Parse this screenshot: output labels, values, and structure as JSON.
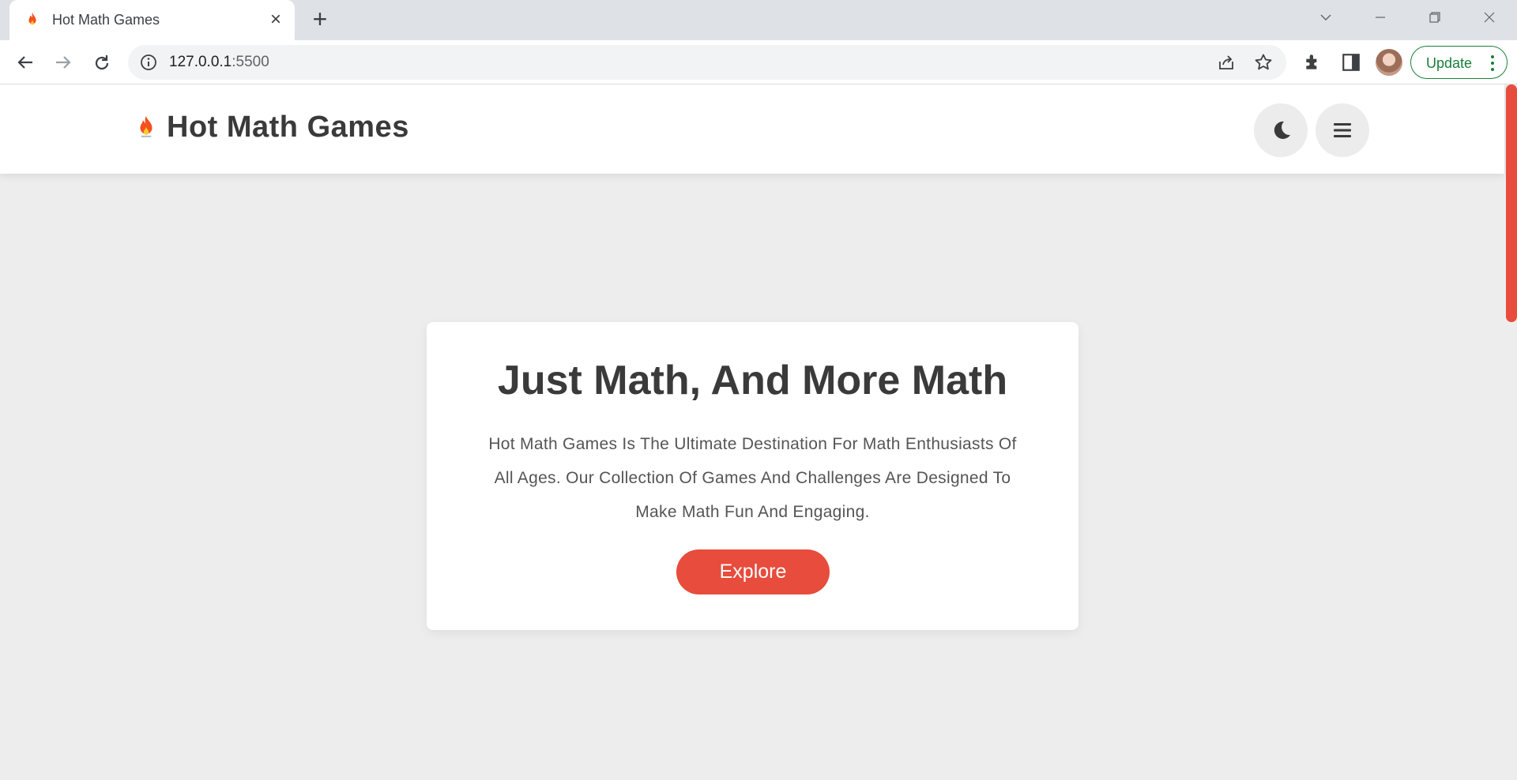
{
  "browser": {
    "tab_title": "Hot Math Games",
    "url_host": "127.0.0.1",
    "url_port": ":5500",
    "update_label": "Update"
  },
  "icons": {
    "favicon": "fire-icon",
    "theme_toggle": "moon-icon",
    "menu": "hamburger-icon"
  },
  "site": {
    "title": "Hot Math Games"
  },
  "hero": {
    "title": "Just Math, And More Math",
    "description": "Hot Math Games Is The Ultimate Destination For Math Enthusiasts Of All Ages. Our Collection Of Games And Challenges Are Designed To Make Math Fun And Engaging.",
    "button_label": "Explore"
  },
  "colors": {
    "accent": "#e74c3c",
    "page_bg": "#ededed",
    "text": "#3a3a3a"
  }
}
